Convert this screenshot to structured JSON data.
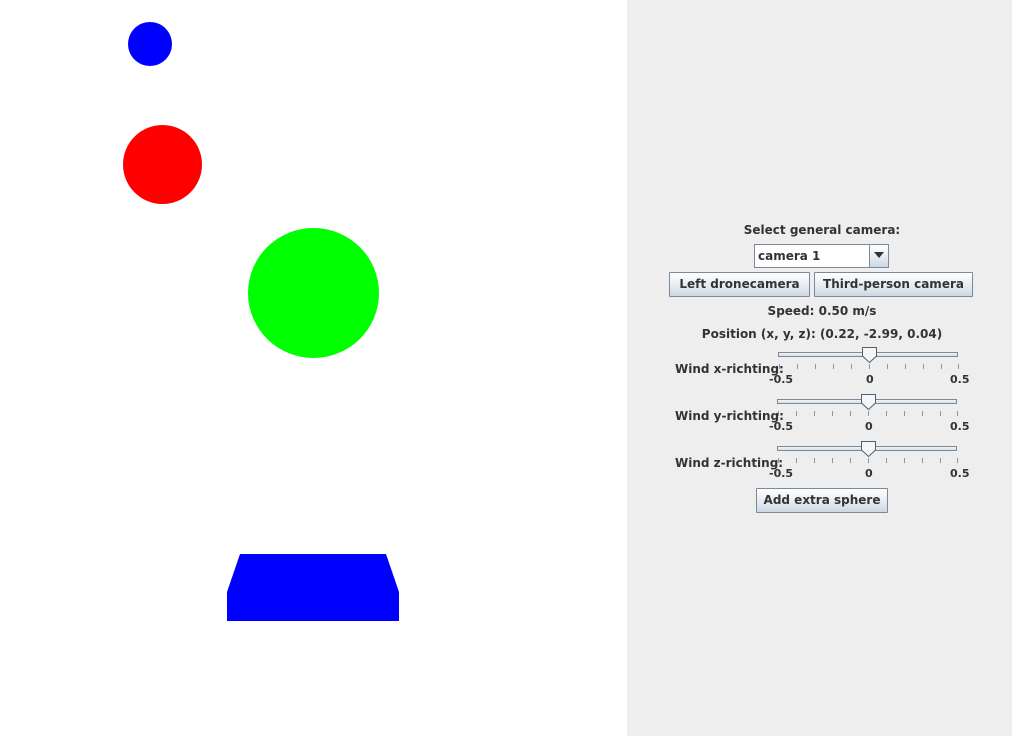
{
  "scene": {
    "colors": {
      "background": "#ffffff",
      "sphere_blue": "#0000ff",
      "sphere_red": "#ff0000",
      "sphere_green": "#00ff00",
      "drone": "#0000ff"
    }
  },
  "panel": {
    "background": "#eeeeee",
    "camera_label": "Select general camera:",
    "camera_select": {
      "value": "camera 1",
      "icon": "chevron-down-icon"
    },
    "left_drone_camera_label": "Left dronecamera",
    "third_person_camera_label": "Third-person camera",
    "speed_text": "Speed: 0.50 m/s",
    "position_text": "Position (x, y, z): (0.22, -2.99, 0.04)",
    "wind": [
      {
        "label": "Wind x-richting:",
        "min_label": "-0.5",
        "mid_label": "0",
        "max_label": "0.5",
        "value": 0
      },
      {
        "label": "Wind y-richting:",
        "min_label": "-0.5",
        "mid_label": "0",
        "max_label": "0.5",
        "value": 0
      },
      {
        "label": "Wind z-richting:",
        "min_label": "-0.5",
        "mid_label": "0",
        "max_label": "0.5",
        "value": 0
      }
    ],
    "add_sphere_label": "Add extra sphere"
  }
}
